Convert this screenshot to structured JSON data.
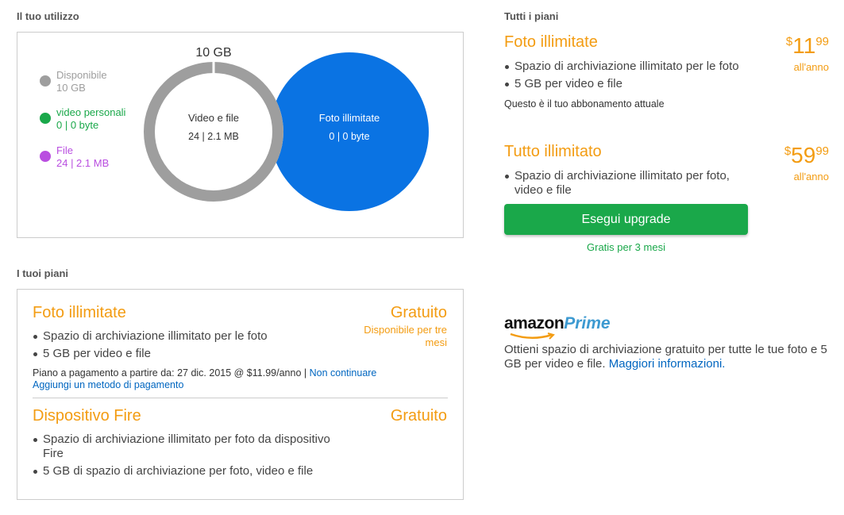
{
  "usage": {
    "title": "Il tuo utilizzo",
    "legend": [
      {
        "name": "Disponibile",
        "value": "10 GB",
        "color": "#9e9e9e"
      },
      {
        "name": "video personali",
        "value": "0 | 0 byte",
        "color": "#1aa84a"
      },
      {
        "name": "File",
        "value": "24 | 2.1 MB",
        "color": "#b94ee0"
      }
    ],
    "capacity_label": "10 GB",
    "ring": {
      "title": "Video e file",
      "value": "24 | 2.1 MB",
      "color": "#9e9e9e"
    },
    "circle": {
      "title": "Foto illimitate",
      "value": "0 | 0 byte",
      "color": "#0a73e3"
    }
  },
  "my_plans": {
    "title": "I tuoi piani",
    "plans": [
      {
        "name": "Foto illimitate",
        "price": "Gratuito",
        "sub": "Disponibile per tre mesi",
        "bullets": [
          "Spazio di archiviazione illimitato per le foto",
          "5 GB per video e file"
        ],
        "billing_text": "Piano a pagamento a partire da: 27 dic. 2015 @ $11.99/anno |",
        "cancel_link": "Non continuare",
        "add_payment_link": "Aggiungi un metodo di pagamento"
      },
      {
        "name": "Dispositivo Fire",
        "price": "Gratuito",
        "bullets": [
          "Spazio di archiviazione illimitato per foto da dispositivo Fire",
          "5 GB di spazio di archiviazione per foto, video e file"
        ]
      }
    ]
  },
  "all_plans": {
    "title": "Tutti i piani",
    "plans": [
      {
        "name": "Foto illimitate",
        "price_currency": "$",
        "price_whole": "11",
        "price_cents": "99",
        "period": "all'anno",
        "bullets": [
          "Spazio di archiviazione illimitato per le foto",
          "5 GB per video e file"
        ],
        "note": "Questo è il tuo abbonamento attuale"
      },
      {
        "name": "Tutto illimitato",
        "price_currency": "$",
        "price_whole": "59",
        "price_cents": "99",
        "period": "all'anno",
        "bullets": [
          "Spazio di archiviazione illimitato per foto, video e file"
        ],
        "button": "Esegui upgrade",
        "button_note": "Gratis per 3 mesi"
      }
    ]
  },
  "prime": {
    "logo_amazon": "amazon",
    "logo_prime": "Prime",
    "description": "Ottieni spazio di archiviazione gratuito per tutte le tue foto e 5 GB per video e file.",
    "link": "Maggiori informazioni."
  },
  "colors": {
    "accent": "#f39c12",
    "green": "#1aa84a",
    "link": "#0066c0",
    "blue": "#0a73e3",
    "gray": "#9e9e9e",
    "purple": "#b94ee0"
  }
}
